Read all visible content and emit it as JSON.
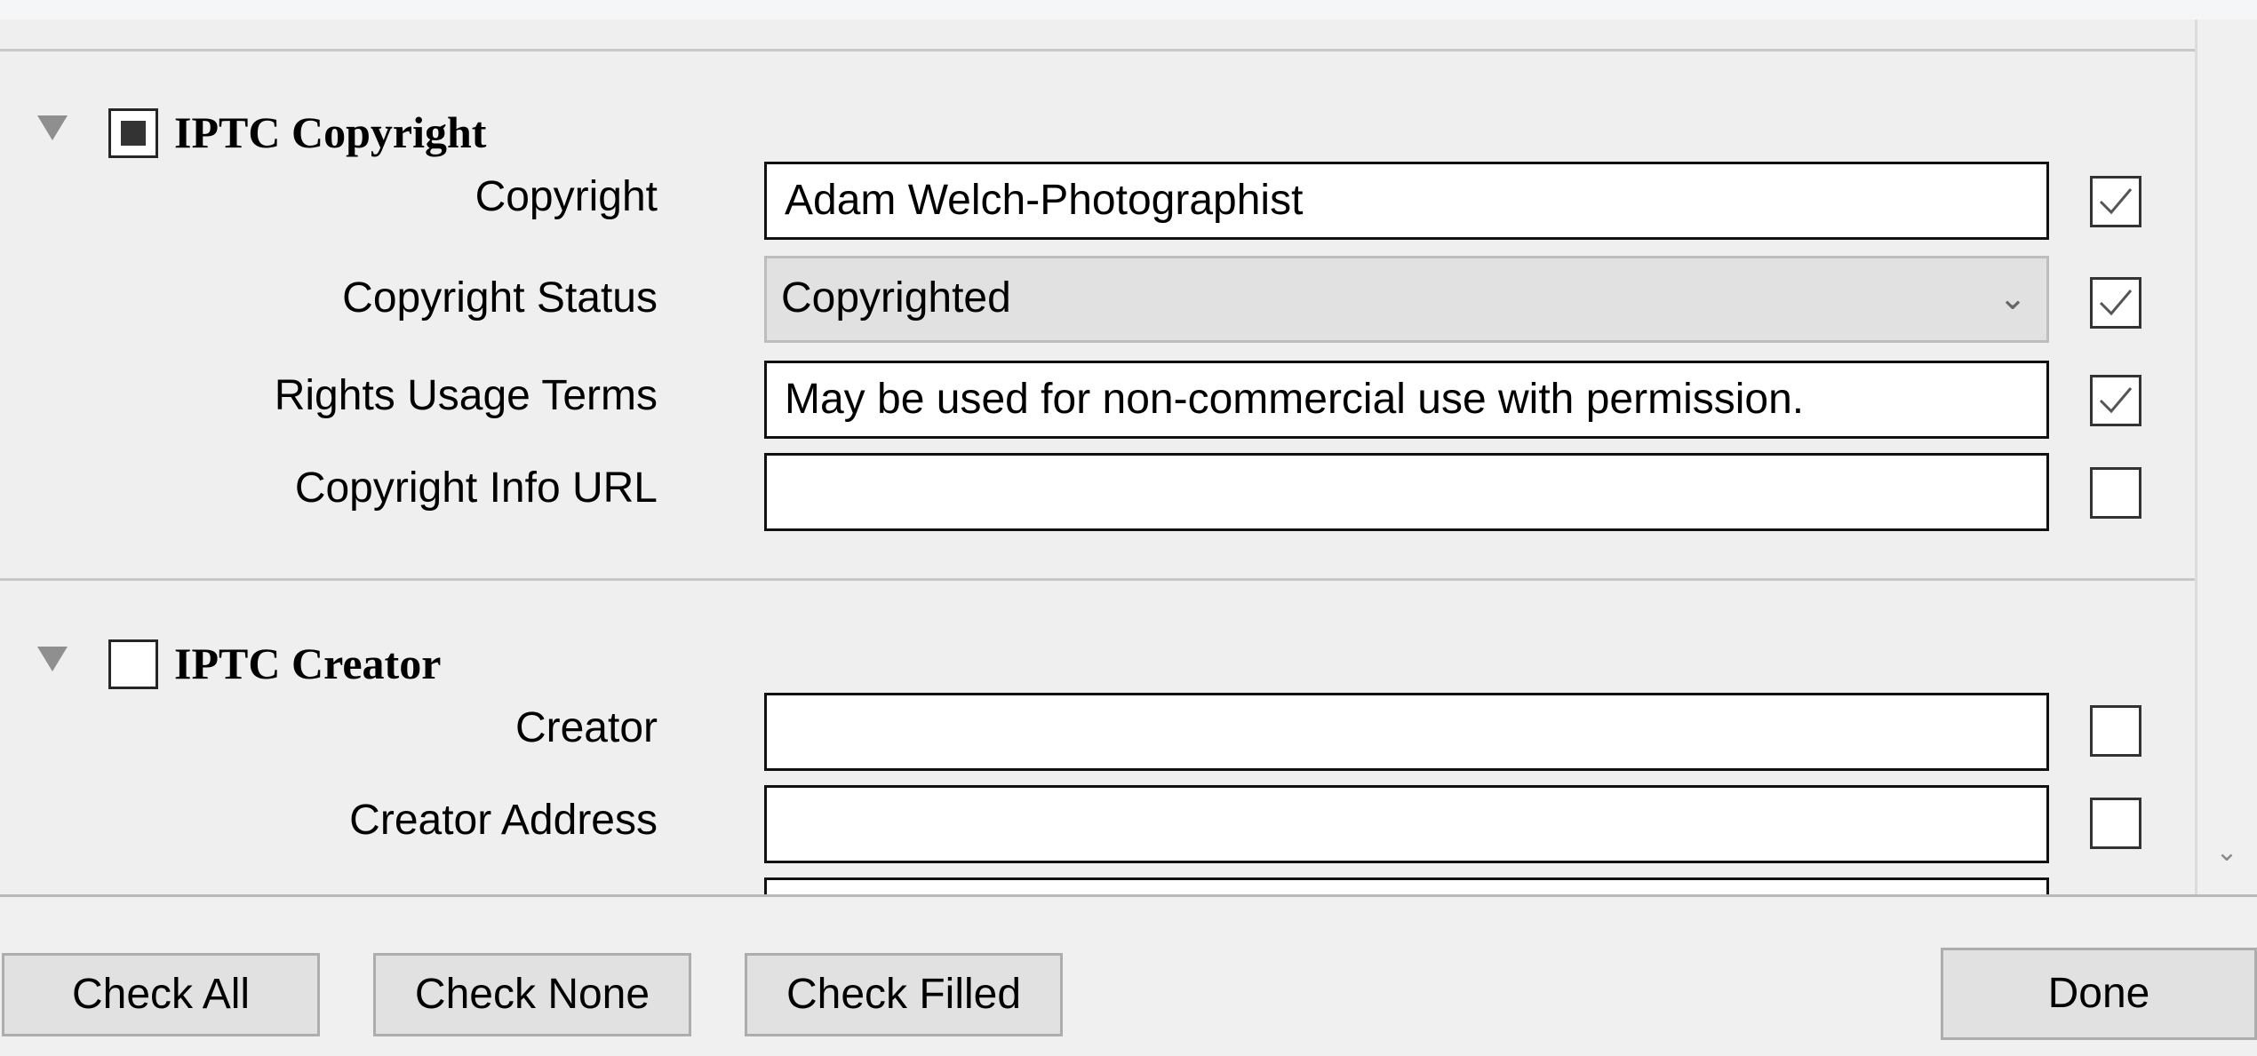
{
  "sections": [
    {
      "title": "IPTC Copyright",
      "section_checked": "partial",
      "fields": [
        {
          "label": "Copyright",
          "value": "Adam Welch-Photographist",
          "type": "text",
          "checked": true
        },
        {
          "label": "Copyright Status",
          "value": "Copyrighted",
          "type": "select",
          "checked": true
        },
        {
          "label": "Rights Usage Terms",
          "value": "May be used for non-commercial use with permission.",
          "type": "text",
          "checked": true
        },
        {
          "label": "Copyright Info URL",
          "value": "",
          "type": "text",
          "checked": false
        }
      ]
    },
    {
      "title": "IPTC Creator",
      "section_checked": "unchecked",
      "fields": [
        {
          "label": "Creator",
          "value": "",
          "type": "text",
          "checked": false
        },
        {
          "label": "Creator Address",
          "value": "",
          "type": "text",
          "checked": false
        }
      ]
    }
  ],
  "buttons": {
    "check_all": "Check All",
    "check_none": "Check None",
    "check_filled": "Check Filled",
    "done": "Done"
  },
  "icons": {
    "expand": "triangle-down-icon",
    "dropdown": "chevron-down-icon",
    "scroll_down": "chevron-down-icon"
  },
  "colors": {
    "panel_bg": "#efefef",
    "separator": "#c8c8c8",
    "button_bg": "#e1e1e1",
    "select_bg": "#e1e1e1"
  }
}
